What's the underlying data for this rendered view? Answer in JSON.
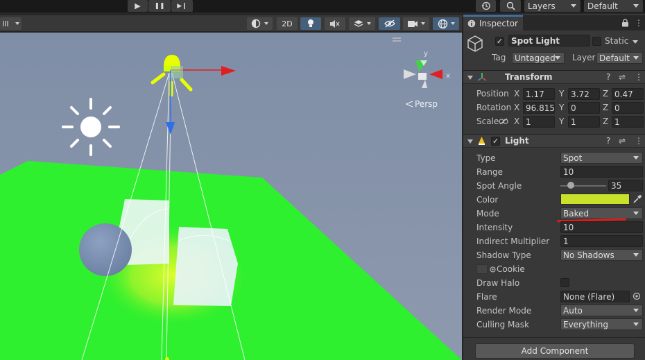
{
  "toolbar": {
    "play_icon": "▶",
    "pause_icon": "❚❚",
    "step_icon": "▶❙",
    "history_icon": "history-icon",
    "search_icon": "search-icon",
    "layers_label": "Layers",
    "layout_label": "Default"
  },
  "scene_toolbar": {
    "mode_2d_label": "2D",
    "persp_label": "Persp"
  },
  "inspector": {
    "tab_label": "Inspector",
    "object_name": "Spot Light",
    "static_label": "Static",
    "tag_label": "Tag",
    "tag_value": "Untagged",
    "layer_label": "Layer",
    "layer_value": "Default",
    "transform": {
      "title": "Transform",
      "position_label": "Position",
      "rotation_label": "Rotation",
      "scale_label": "Scale",
      "axis_x": "X",
      "axis_y": "Y",
      "axis_z": "Z",
      "position": {
        "x": "1.17",
        "y": "3.72",
        "z": "0.47"
      },
      "rotation": {
        "x": "96.815",
        "y": "0",
        "z": "0"
      },
      "scale": {
        "x": "1",
        "y": "1",
        "z": "1"
      }
    },
    "light": {
      "title": "Light",
      "type_label": "Type",
      "type_value": "Spot",
      "range_label": "Range",
      "range_value": "10",
      "spot_angle_label": "Spot Angle",
      "spot_angle_value": "35",
      "spot_angle_slider": 0.09,
      "color_label": "Color",
      "color_value": "#c8e22c",
      "mode_label": "Mode",
      "mode_value": "Baked",
      "intensity_label": "Intensity",
      "intensity_value": "10",
      "indirect_label": "Indirect Multiplier",
      "indirect_value": "1",
      "shadow_label": "Shadow Type",
      "shadow_value": "No Shadows",
      "cookie_label": "Cookie",
      "draw_halo_label": "Draw Halo",
      "flare_label": "Flare",
      "flare_value": "None (Flare)",
      "render_mode_label": "Render Mode",
      "render_mode_value": "Auto",
      "culling_label": "Culling Mask",
      "culling_value": "Everything"
    },
    "add_component_label": "Add Component"
  },
  "colors": {
    "accent": "#3a79bb",
    "annotation_underline": "#e01b1b",
    "ground": "#2ef02e"
  }
}
